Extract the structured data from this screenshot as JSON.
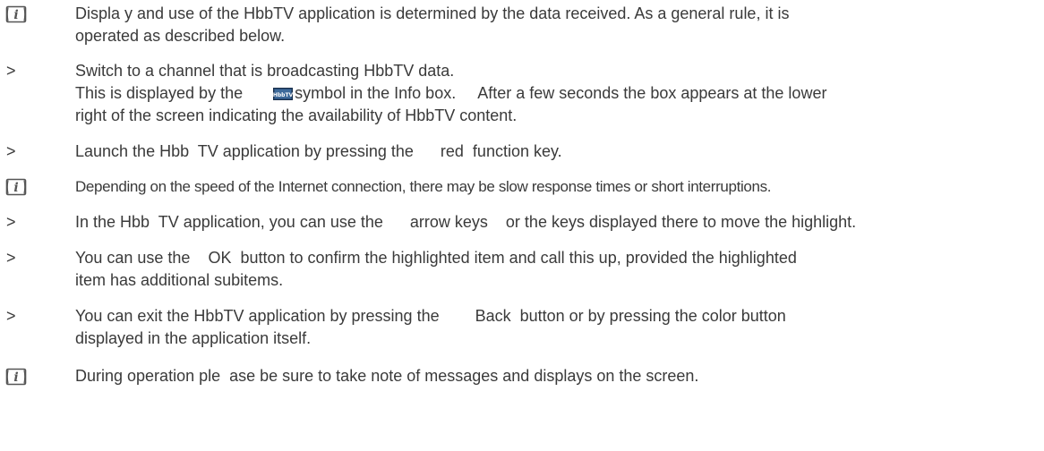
{
  "rows": [
    {
      "marker": "info-icon",
      "lines": [
        "Displa y and use of the HbbTV application is determined by the data received. As a general rule, it is",
        "operated as described below."
      ]
    },
    {
      "marker": ">",
      "line1": "Switch to a channel that is broadcasting HbbTV data.",
      "line2_before": "This is displayed by the",
      "line2_after": "symbol in the Info box.     After a few seconds the box appears at the lower",
      "line3": "right of the screen indicating the availability of HbbTV content."
    },
    {
      "marker": ">",
      "lines": [
        "Launch the Hbb  TV application by pressing the      red  function key."
      ]
    },
    {
      "marker": "info-icon",
      "lines": [
        "Depending on the speed of the Internet connection, there may be slow response times or short interruptions."
      ]
    },
    {
      "marker": ">",
      "lines": [
        "In the Hbb  TV application, you can use the      arrow keys    or the keys displayed there to move the highlight."
      ]
    },
    {
      "marker": ">",
      "lines": [
        "You can use the    OK  button to confirm the highlighted item and call this up, provided the highlighted",
        "item has additional subitems."
      ]
    },
    {
      "marker": ">",
      "lines": [
        "You can exit the HbbTV application by pressing the        Back  button or by pressing the color button",
        "displayed in the application itself."
      ]
    },
    {
      "marker": "info-icon",
      "lines": [
        "During operation ple  ase be sure to take note of messages and displays on the screen."
      ]
    }
  ],
  "colors": {
    "text": "#3a3a3a",
    "icon": "#555555",
    "symbol_bg": "#2b4f7a"
  }
}
